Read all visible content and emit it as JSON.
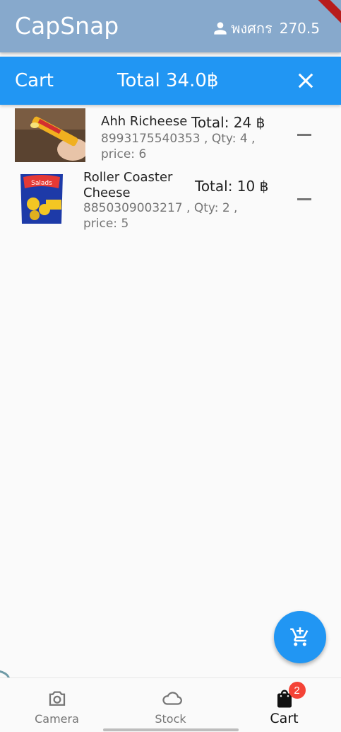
{
  "app": {
    "title": "CapSnap",
    "user_name": "พงศกร",
    "balance": "270.5"
  },
  "cart_header": {
    "title": "Cart",
    "total": "Total 34.0฿"
  },
  "items": [
    {
      "name": "Ahh Richeese",
      "total": "Total: 24 ฿",
      "barcode_qty": "8993175540353  , Qty: 4 ,",
      "price": "price: 6"
    },
    {
      "name": "Roller Coaster Cheese",
      "total": "Total: 10 ฿",
      "barcode_qty": "8850309003217  , Qty: 2 ,",
      "price": "price: 5"
    }
  ],
  "bottom_nav": [
    {
      "label": "Camera",
      "icon": "camera-icon"
    },
    {
      "label": "Stock",
      "icon": "cloud-icon"
    },
    {
      "label": "Cart",
      "icon": "shopping-bag-icon",
      "badge": "2",
      "active": true
    }
  ],
  "fab": {
    "icon": "add-shopping-cart-icon"
  },
  "colors": {
    "appbar": "#87a9cc",
    "primary": "#2196f3",
    "badge": "#f44336"
  }
}
